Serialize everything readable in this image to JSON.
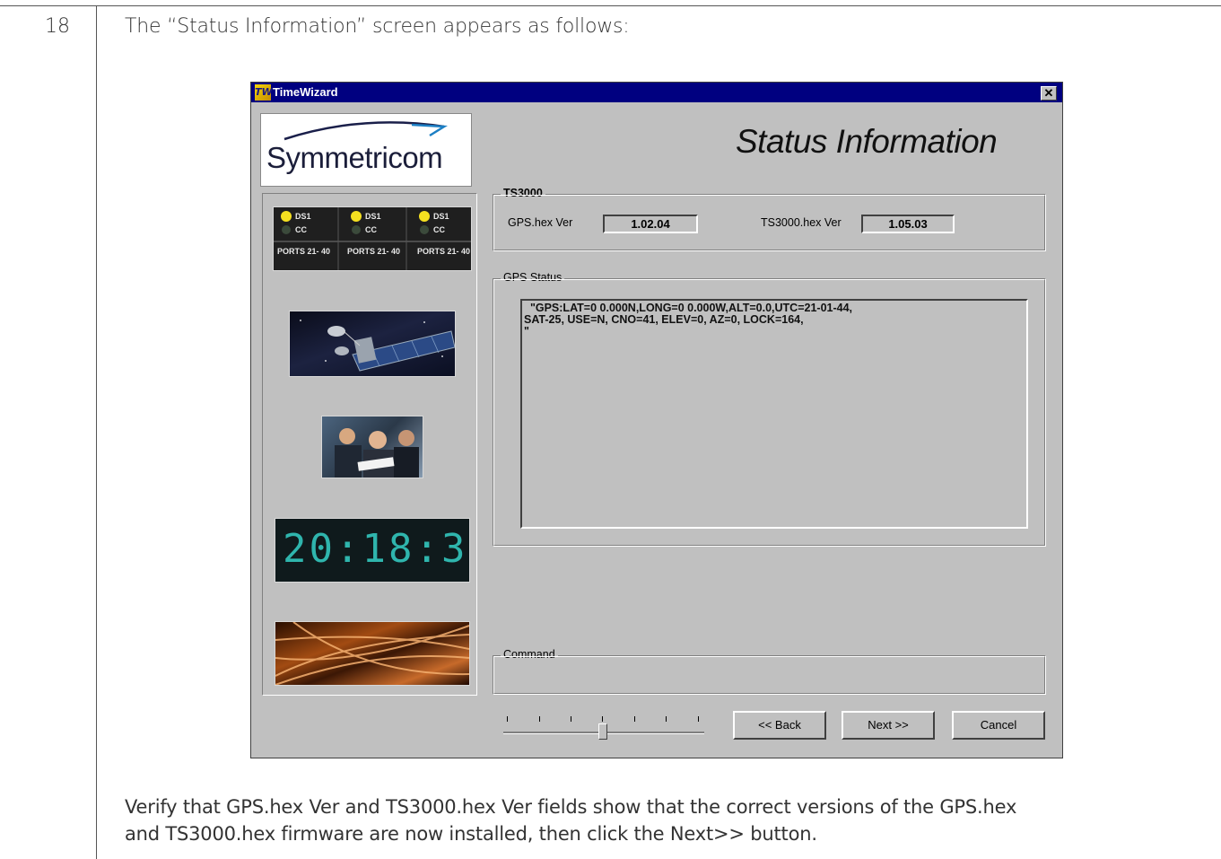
{
  "document": {
    "step_number": "18",
    "intro_text": "The “Status Information” screen appears as follows:",
    "outro_line_1": "Verify that GPS.hex Ver and TS3000.hex Ver fields show that the correct versions of the GPS.hex",
    "outro_line_2": "and TS3000.hex firmware are now installed, then click the Next>> button."
  },
  "window": {
    "title": "TimeWizard",
    "app_icon_text": "TW",
    "close_glyph": "✕",
    "logo_text": "Symmetricom",
    "heading": "Status Information"
  },
  "sidebar": {
    "led_labels": [
      "DS1",
      "CC",
      "PORTS 21- 40"
    ],
    "clock_text": "20:18:3"
  },
  "ts3000_group": {
    "label": "TS3000",
    "gps_hex_label": "GPS.hex Ver",
    "gps_hex_value": "1.02.04",
    "ts3000_hex_label": "TS3000.hex Ver",
    "ts3000_hex_value": "1.05.03"
  },
  "gps_status_group": {
    "label": "GPS Status",
    "text": "  \"GPS:LAT=0 0.000N,LONG=0 0.000W,ALT=0.0,UTC=21-01-44,\nSAT-25, USE=N, CNO=41, ELEV=0, AZ=0, LOCK=164,\n\""
  },
  "command_group": {
    "label": "Command"
  },
  "buttons": {
    "back": "<< Back",
    "next": "Next >>",
    "cancel": "Cancel"
  },
  "wizard_progress": {
    "step_position": 3,
    "step_count": 7
  }
}
